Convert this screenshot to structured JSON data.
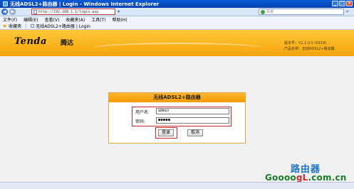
{
  "window": {
    "title": "无线ADSL2+路由器 | Login - Windows Internet Explorer"
  },
  "address_bar": {
    "url": "http://192.168.1.1/login.asp",
    "search_placeholder": "百度"
  },
  "menu": {
    "items": [
      "文件(F)",
      "编辑(E)",
      "查看(V)",
      "收藏夹(A)",
      "工具(T)",
      "帮助(H)"
    ]
  },
  "favorites_bar": {
    "favorites_label": "收藏夹",
    "tab_title": "无线ADSL2+路由器 | Login"
  },
  "header": {
    "logo": "Tenda",
    "logo_cn": "腾达",
    "version_line": "版本号：V1.1.0.5 (0319)",
    "product_line": "产品名称：无线ADSL2+路由器"
  },
  "login": {
    "title": "无线ADSL2+路由器",
    "username_label": "用户名:",
    "username_value": "admin",
    "password_label": "密码:",
    "password_value": "●●●●●",
    "login_button": "登录",
    "cancel_button": "取消"
  },
  "watermark": {
    "text_cn": "路由器",
    "text_en_prefix": "Goooo",
    "text_en_gl": "gL",
    "text_en_suffix": ".com.cn"
  },
  "colors": {
    "banner": "#f5a30c",
    "highlight": "#c62828",
    "titlebar": "#0a5ad6"
  }
}
